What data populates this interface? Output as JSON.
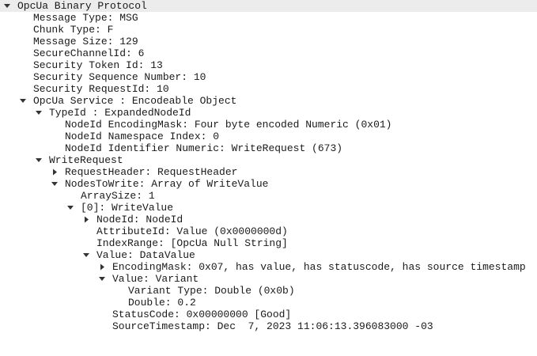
{
  "tree": {
    "rows": [
      "OpcUa Binary Protocol",
      "Message Type: MSG",
      "Chunk Type: F",
      "Message Size: 129",
      "SecureChannelId: 6",
      "Security Token Id: 13",
      "Security Sequence Number: 10",
      "Security RequestId: 10",
      "OpcUa Service : Encodeable Object",
      "TypeId : ExpandedNodeId",
      "NodeId EncodingMask: Four byte encoded Numeric (0x01)",
      "NodeId Namespace Index: 0",
      "NodeId Identifier Numeric: WriteRequest (673)",
      "WriteRequest",
      "RequestHeader: RequestHeader",
      "NodesToWrite: Array of WriteValue",
      "ArraySize: 1",
      "[0]: WriteValue",
      "NodeId: NodeId",
      "AttributeId: Value (0x0000000d)",
      "IndexRange: [OpcUa Null String]",
      "Value: DataValue",
      "EncodingMask: 0x07, has value, has statuscode, has source timestamp",
      "Value: Variant",
      "Variant Type: Double (0x0b)",
      "Double: 0.2",
      "StatusCode: 0x00000000 [Good]",
      "SourceTimestamp: Dec  7, 2023 11:06:13.396083000 -03"
    ]
  },
  "colors": {
    "selected_row": "#ececec",
    "text": "#1a1a1a",
    "toggle": "#333333"
  },
  "icons": {
    "expanded": "chevron-down-icon",
    "collapsed": "chevron-right-icon"
  }
}
